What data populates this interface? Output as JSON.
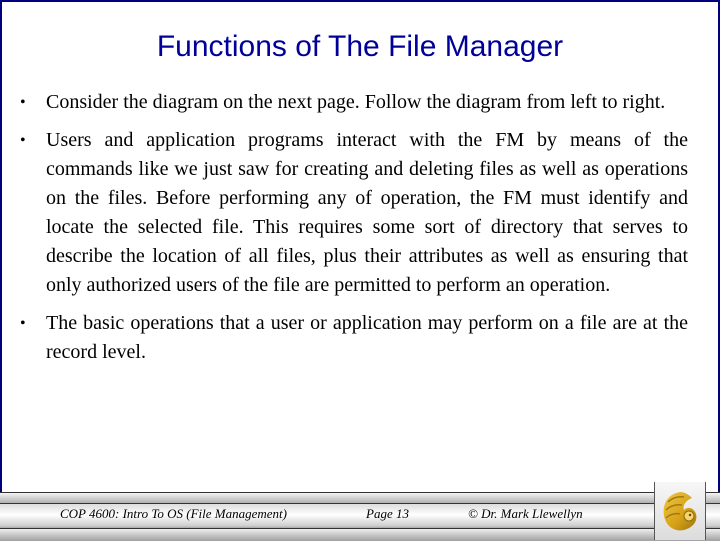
{
  "slide": {
    "title": "Functions of The File Manager",
    "bullets": [
      {
        "text": "Consider the diagram on the next page. Follow the diagram from left to right."
      },
      {
        "text": "Users and application programs interact with the FM by means of the commands like we just saw for creating and deleting files as well as operations on the files.  Before performing any of operation, the FM must identify and locate the selected file.  This requires some sort of directory that serves to describe the location of all files, plus their attributes as well as ensuring that only authorized users of the file are permitted to perform an operation."
      },
      {
        "text": "The basic operations that a user or application may perform on a file are at the record level."
      }
    ],
    "bullet_glyph": "•"
  },
  "footer": {
    "course": "COP 4600: Intro To OS  (File Management)",
    "page": "Page 13",
    "copyright": "© Dr. Mark Llewellyn",
    "logo_icon": "pegasus-logo-icon"
  },
  "colors": {
    "border": "#000080",
    "title": "#000099",
    "logo_gold": "#d4a017"
  }
}
